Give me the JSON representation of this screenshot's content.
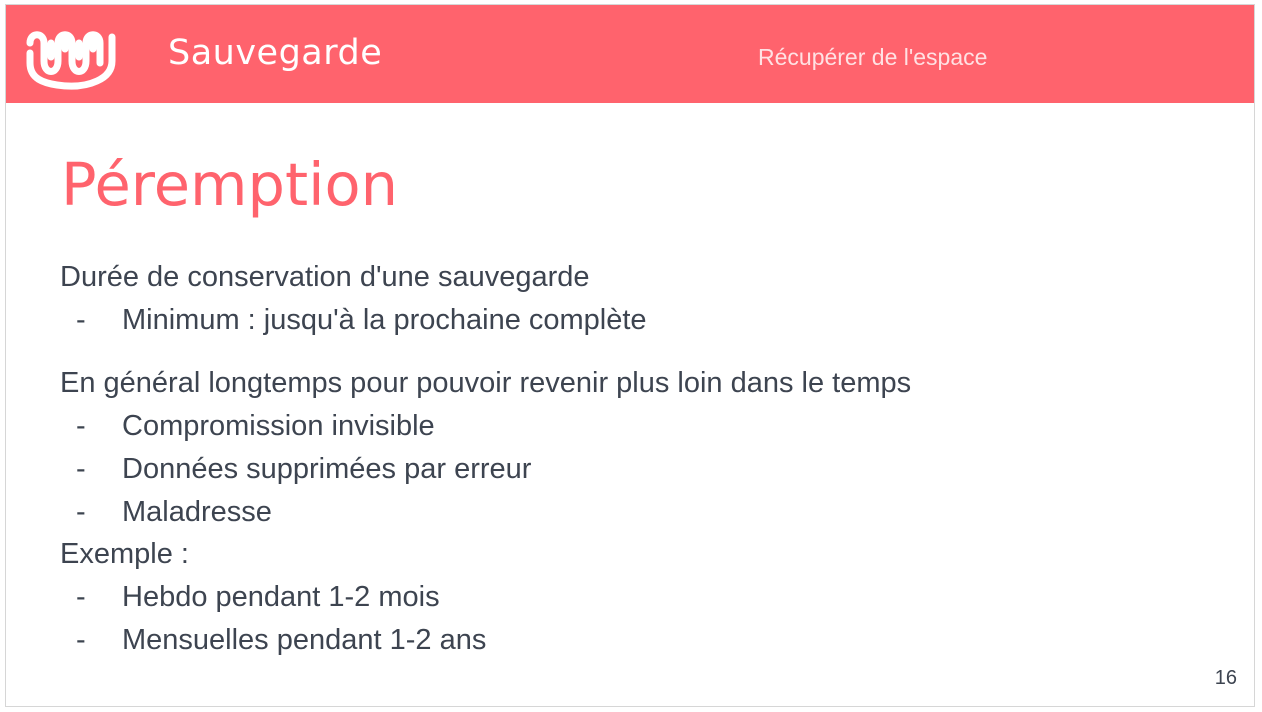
{
  "header": {
    "title": "Sauvegarde",
    "section": "Récupérer de l'espace",
    "logo_icon": "wave-logo-icon",
    "background_color": "#ff636d"
  },
  "slide": {
    "title": "Péremption",
    "title_color": "#ff636d",
    "text_color": "#3d4450",
    "blocks": [
      {
        "text": "Durée de conservation d'une sauvegarde",
        "bullets": [
          "Minimum : jusqu'à la prochaine complète"
        ]
      },
      {
        "text": "En général longtemps pour pouvoir revenir plus loin dans le temps",
        "bullets": [
          "Compromission invisible",
          "Données supprimées par erreur",
          "Maladresse"
        ]
      },
      {
        "text": "Exemple :",
        "bullets": [
          "Hebdo pendant 1-2 mois",
          "Mensuelles pendant 1-2 ans"
        ]
      }
    ],
    "bullet_marker": "-",
    "page_number": "16"
  }
}
